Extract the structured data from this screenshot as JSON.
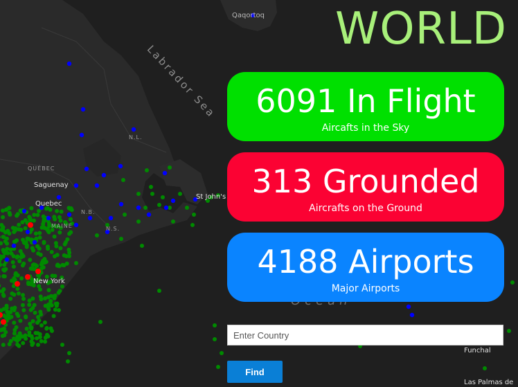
{
  "title": "WORLD",
  "stats": {
    "in_flight": {
      "value": "6091 In Flight",
      "caption": "Aircafts in the Sky",
      "color": "#00e000"
    },
    "grounded": {
      "value": "313 Grounded",
      "caption": "Aircrafts on the Ground",
      "color": "#fb0233"
    },
    "airports": {
      "value": "4188 Airports",
      "caption": "Major Airports",
      "color": "#0a84ff"
    }
  },
  "search": {
    "placeholder": "Enter Country",
    "value": ""
  },
  "find_button": {
    "label": "Find"
  },
  "map": {
    "labels": {
      "qaqortoq": "Qaqortoq",
      "labrador_sea": "Labrador Sea",
      "nl": "N.L.",
      "quebec_region": "QUÉBEC",
      "saguenay": "Saguenay",
      "quebec_city": "Quebec",
      "nb": "N.B.",
      "ns": "N.S.",
      "maine": "MAINE",
      "new_york": "New York",
      "st_johns": "St John's",
      "ocean": "Ocean",
      "funchal": "Funchal",
      "las_palmas": "Las Palmas de"
    },
    "colors": {
      "background": "#1f1f1f",
      "land": "#2a2a2a",
      "in_flight": "#008a00",
      "airport": "#0000ff",
      "grounded": "#ff0000"
    }
  }
}
